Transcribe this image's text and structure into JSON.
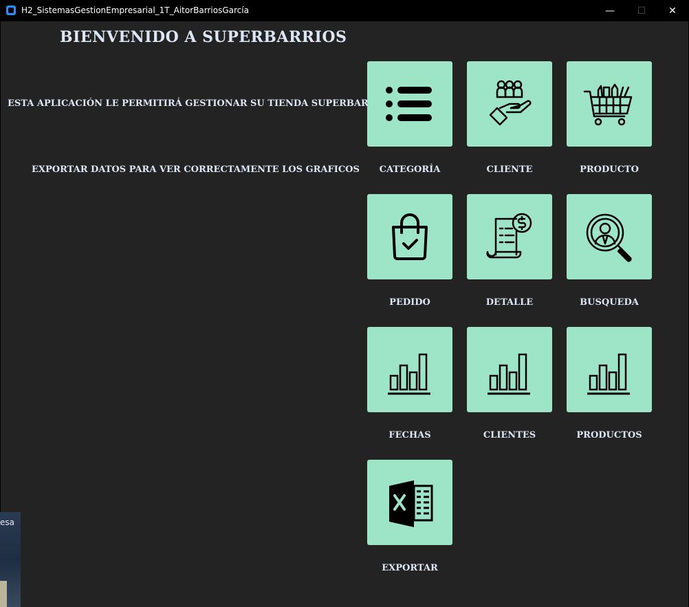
{
  "window": {
    "title": "H2_SistemasGestionEmpresarial_1T_AitorBarriosGarcía",
    "minimize": "—",
    "maximize": "☐",
    "close": "✕"
  },
  "main": {
    "heading": "BIENVENIDO A SUPERBARRIOS",
    "description": "ESTA APLICACIÓN LE PERMITIRÁ GESTIONAR SU TIENDA SUPERBARRIOS",
    "export_hint": "EXPORTAR DATOS PARA VER CORRECTAMENTE LOS GRAFICOS"
  },
  "tiles": [
    {
      "label": "CATEGORÍA",
      "icon": "list-icon"
    },
    {
      "label": "CLIENTE",
      "icon": "customers-hand-icon"
    },
    {
      "label": "PRODUCTO",
      "icon": "shopping-cart-icon"
    },
    {
      "label": "PEDIDO",
      "icon": "shopping-bag-check-icon"
    },
    {
      "label": "DETALLE",
      "icon": "invoice-dollar-icon"
    },
    {
      "label": "BUSQUEDA",
      "icon": "person-search-icon"
    },
    {
      "label": "FECHAS",
      "icon": "bar-chart-icon"
    },
    {
      "label": "CLIENTES",
      "icon": "bar-chart-icon"
    },
    {
      "label": "PRODUCTOS",
      "icon": "bar-chart-icon"
    },
    {
      "label": "EXPORTAR",
      "icon": "excel-icon"
    }
  ],
  "background_window": {
    "fragment_text": "esa"
  },
  "colors": {
    "tile_bg": "#9ee5c8",
    "window_bg": "#232323",
    "text": "#dde6f4"
  }
}
